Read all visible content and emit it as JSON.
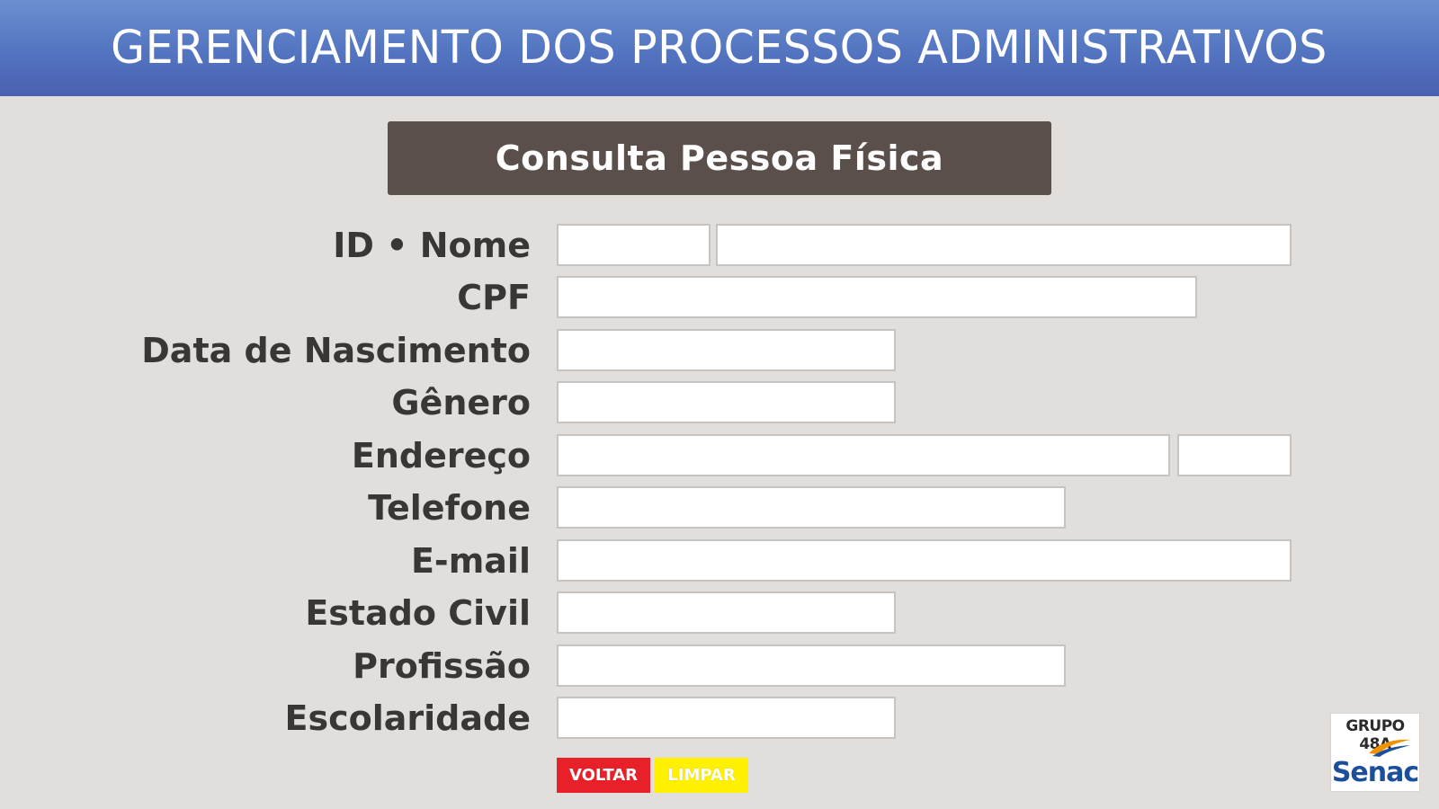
{
  "header": {
    "title": "GERENCIAMENTO DOS PROCESSOS ADMINISTRATIVOS"
  },
  "form": {
    "title": "Consulta Pessoa Física",
    "labels": {
      "id_nome": "ID • Nome",
      "cpf": "CPF",
      "data_nascimento": "Data de Nascimento",
      "genero": "Gênero",
      "endereco": "Endereço",
      "telefone": "Telefone",
      "email": "E-mail",
      "estado_civil": "Estado Civil",
      "profissao": "Profissão",
      "escolaridade": "Escolaridade"
    },
    "values": {
      "id": "",
      "nome": "",
      "cpf": "",
      "data_nascimento": "",
      "genero": "",
      "endereco": "",
      "endereco_numero": "",
      "telefone": "",
      "email": "",
      "estado_civil": "",
      "profissao": "",
      "escolaridade": ""
    }
  },
  "buttons": {
    "voltar": "VOLTAR",
    "limpar": "LIMPAR"
  },
  "logo": {
    "group": "GRUPO 48A",
    "brand": "Senac",
    "icon": "senac-swoosh-icon"
  },
  "colors": {
    "header": "#5374c0",
    "title_bar": "#5a4f4b",
    "background": "#e1dedb",
    "voltar": "#e8202a",
    "limpar": "#fff100",
    "label_text": "#3a3636"
  }
}
